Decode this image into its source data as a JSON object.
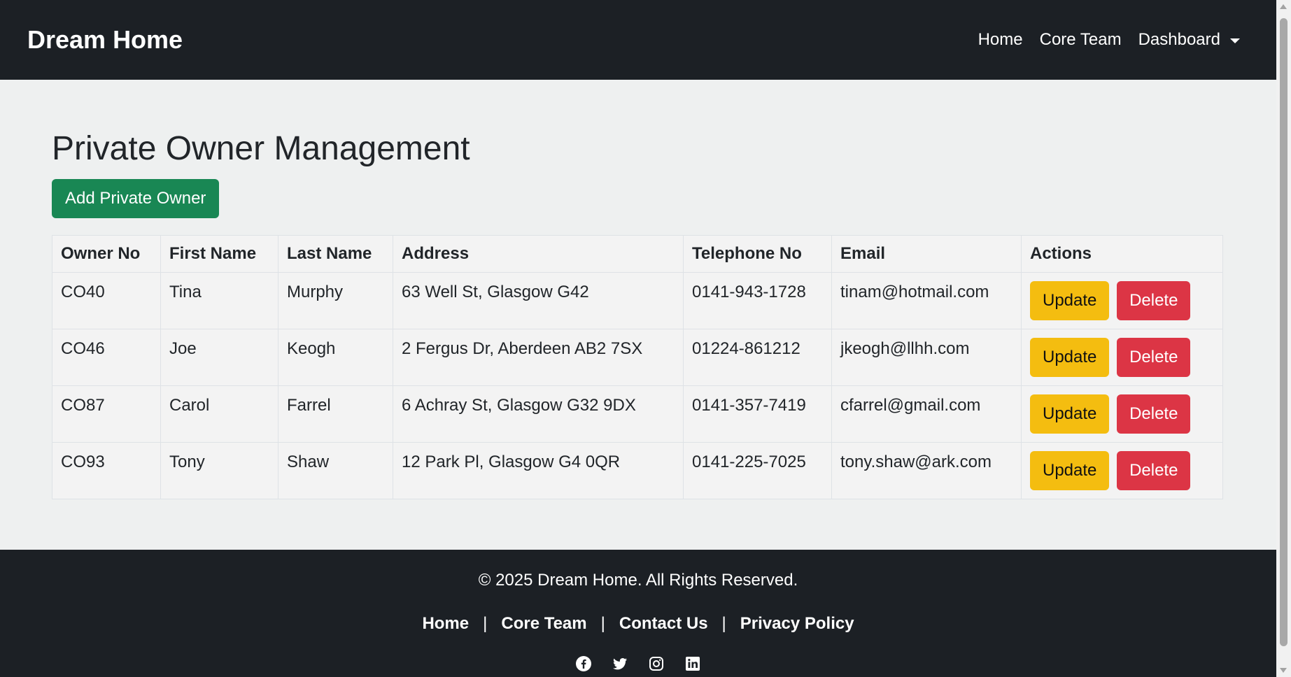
{
  "navbar": {
    "brand": "Dream Home",
    "links": {
      "home": "Home",
      "core_team": "Core Team",
      "dashboard": "Dashboard"
    }
  },
  "main": {
    "title": "Private Owner Management",
    "add_button": "Add Private Owner",
    "table": {
      "headers": [
        "Owner No",
        "First Name",
        "Last Name",
        "Address",
        "Telephone No",
        "Email",
        "Actions"
      ],
      "update_label": "Update",
      "delete_label": "Delete",
      "rows": [
        [
          "CO40",
          "Tina",
          "Murphy",
          "63 Well St, Glasgow G42",
          "0141-943-1728",
          "tinam@hotmail.com"
        ],
        [
          "CO46",
          "Joe",
          "Keogh",
          "2 Fergus Dr, Aberdeen AB2 7SX",
          "01224-861212",
          "jkeogh@llhh.com"
        ],
        [
          "CO87",
          "Carol",
          "Farrel",
          "6 Achray St, Glasgow G32 9DX",
          "0141-357-7419",
          "cfarrel@gmail.com"
        ],
        [
          "CO93",
          "Tony",
          "Shaw",
          "12 Park Pl, Glasgow G4 0QR",
          "0141-225-7025",
          "tony.shaw@ark.com"
        ]
      ]
    }
  },
  "footer": {
    "copyright": "© 2025 Dream Home. All Rights Reserved.",
    "links": {
      "home": "Home",
      "core_team": "Core Team",
      "contact": "Contact Us",
      "privacy": "Privacy Policy"
    },
    "separator": "|",
    "socials": [
      "facebook-icon",
      "twitter-icon",
      "instagram-icon",
      "linkedin-icon"
    ]
  },
  "colors": {
    "navbar_bg": "#1c2025",
    "success": "#198754",
    "warning": "#f4bd10",
    "danger": "#dc3545"
  }
}
